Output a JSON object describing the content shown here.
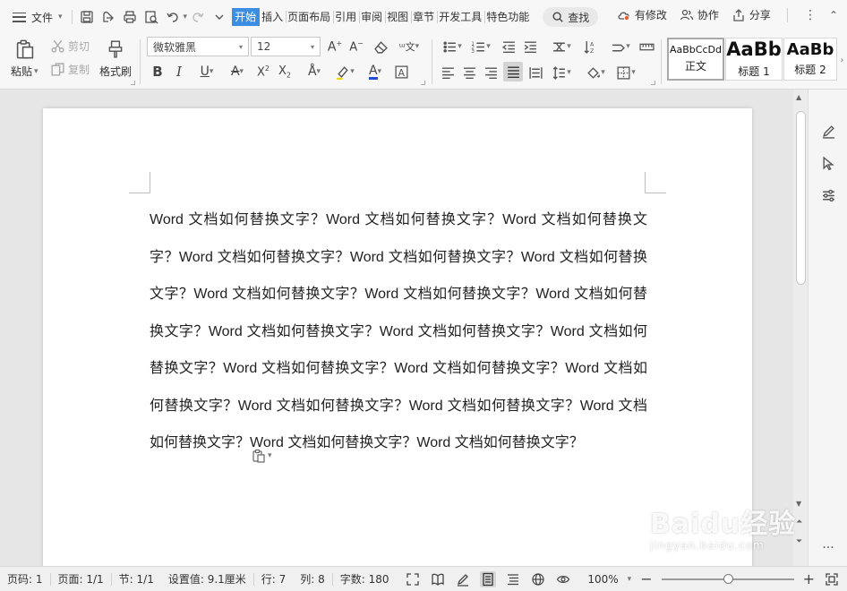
{
  "menubar": {
    "file_label": "文件",
    "tabs": [
      "开始",
      "插入",
      "页面布局",
      "引用",
      "审阅",
      "视图",
      "章节",
      "开发工具",
      "特色功能"
    ],
    "active_tab": "开始",
    "search_label": "查找",
    "right": {
      "revise_label": "有修改",
      "collab_label": "协作",
      "share_label": "分享"
    }
  },
  "ribbon": {
    "paste_label": "粘贴",
    "cut_label": "剪切",
    "copy_label": "复制",
    "format_painter_label": "格式刷",
    "font_name": "微软雅黑",
    "font_size": "12",
    "styles": [
      {
        "sample": "AaBbCcDd",
        "name": "正文"
      },
      {
        "sample": "AaBb",
        "name": "标题 1"
      },
      {
        "sample": "AaBb",
        "name": "标题 2"
      }
    ]
  },
  "document": {
    "text": "Word 文档如何替换文字？Word 文档如何替换文字？Word 文档如何替换文字？Word 文档如何替换文字？Word 文档如何替换文字？Word 文档如何替换文字？Word 文档如何替换文字？Word 文档如何替换文字？Word 文档如何替换文字？Word 文档如何替换文字？Word 文档如何替换文字？Word 文档如何替换文字？Word 文档如何替换文字？Word 文档如何替换文字？Word 文档如何替换文字？Word 文档如何替换文字？Word 文档如何替换文字？Word 文档如何替换文字？Word 文档如何替换文字？Word 文档如何替换文字？"
  },
  "statusbar": {
    "page_code": "页码: 1",
    "page": "页面: 1/1",
    "section": "节: 1/1",
    "setting": "设置值: 9.1厘米",
    "row": "行: 7",
    "col": "列: 8",
    "word_count": "字数: 180",
    "zoom": "100%",
    "zoom_fraction": 0.5
  },
  "watermark": {
    "main": "Baidu经验",
    "sub": "jingyan.baidu.com"
  }
}
